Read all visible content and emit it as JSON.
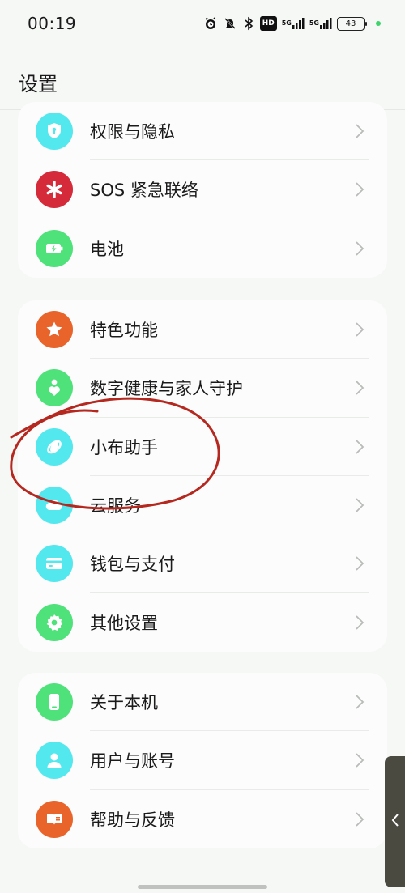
{
  "status_bar": {
    "time": "00:19",
    "hd_label": "HD",
    "net1_label": "5G",
    "net2_label": "5G",
    "battery_level": "43"
  },
  "page": {
    "title": "设置"
  },
  "groups": [
    {
      "items": [
        {
          "label": "权限与隐私",
          "icon": "shield-icon",
          "color": "#52e8ee"
        },
        {
          "label": "SOS 紧急联络",
          "icon": "asterisk-icon",
          "color": "#d42a3a"
        },
        {
          "label": "电池",
          "icon": "battery-icon",
          "color": "#4fe27a"
        }
      ]
    },
    {
      "items": [
        {
          "label": "特色功能",
          "icon": "star-icon",
          "color": "#e8642a"
        },
        {
          "label": "数字健康与家人守护",
          "icon": "heart-person-icon",
          "color": "#4fe27a"
        },
        {
          "label": "小布助手",
          "icon": "breeno-icon",
          "color": "#52e8ee"
        },
        {
          "label": "云服务",
          "icon": "cloud-icon",
          "color": "#52e8ee"
        },
        {
          "label": "钱包与支付",
          "icon": "wallet-icon",
          "color": "#52e8ee"
        },
        {
          "label": "其他设置",
          "icon": "gear-icon",
          "color": "#4fe27a"
        }
      ]
    },
    {
      "items": [
        {
          "label": "关于本机",
          "icon": "phone-icon",
          "color": "#4fe27a"
        },
        {
          "label": "用户与账号",
          "icon": "user-icon",
          "color": "#52e8ee"
        },
        {
          "label": "帮助与反馈",
          "icon": "book-icon",
          "color": "#e8642a"
        }
      ]
    }
  ],
  "colors": {
    "background": "#f6f8f6",
    "card": "#fbfcfb",
    "annotation_circle": "#b5281f",
    "chevron": "#b8bbb8"
  }
}
